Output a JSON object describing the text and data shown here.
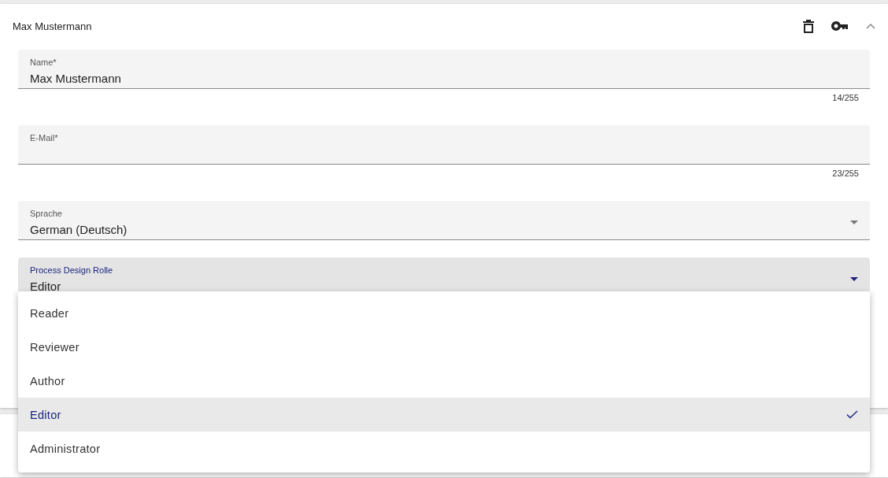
{
  "card": {
    "title": "Max Mustermann",
    "expanded": true
  },
  "fields": [
    {
      "kind": "text",
      "label": "Name*",
      "value": "Max Mustermann",
      "counter": "14/255",
      "focused": false
    },
    {
      "kind": "text",
      "label": "E-Mail*",
      "counter": "23/255",
      "focused": false
    },
    {
      "kind": "select",
      "label": "Sprache",
      "value": "German (Deutsch)",
      "focused": false
    },
    {
      "kind": "select",
      "label": "Process Design Rolle",
      "value": "Editor",
      "focused": true
    }
  ],
  "menu": {
    "options": [
      {
        "label": "Reader",
        "selected": false
      },
      {
        "label": "Reviewer",
        "selected": false
      },
      {
        "label": "Author",
        "selected": false
      },
      {
        "label": "Editor",
        "selected": true
      },
      {
        "label": "Administrator",
        "selected": false
      }
    ]
  }
}
